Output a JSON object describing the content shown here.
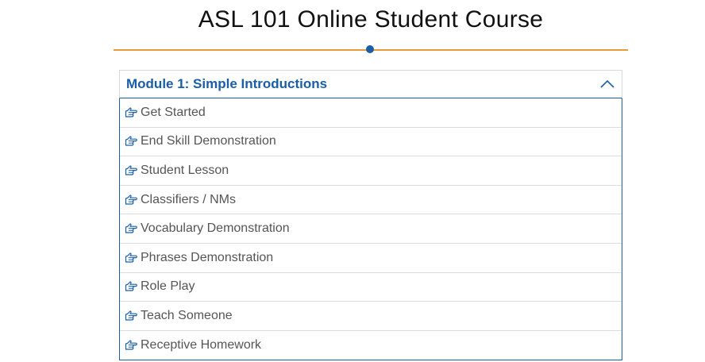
{
  "page": {
    "title": "ASL 101 Online Student Course"
  },
  "colors": {
    "accent_orange": "#e89a3c",
    "accent_blue": "#1a5ea8",
    "item_text": "#555555"
  },
  "module": {
    "header_label": "Module 1: Simple Introductions",
    "expanded": true,
    "items": [
      {
        "label": "Get Started",
        "icon": "pointing-hand-icon"
      },
      {
        "label": "End Skill Demonstration",
        "icon": "pointing-hand-icon"
      },
      {
        "label": "Student Lesson",
        "icon": "pointing-hand-icon"
      },
      {
        "label": "Classifiers / NMs",
        "icon": "pointing-hand-icon"
      },
      {
        "label": "Vocabulary Demonstration",
        "icon": "pointing-hand-icon"
      },
      {
        "label": "Phrases Demonstration",
        "icon": "pointing-hand-icon"
      },
      {
        "label": "Role Play",
        "icon": "pointing-hand-icon"
      },
      {
        "label": "Teach Someone",
        "icon": "pointing-hand-icon"
      },
      {
        "label": "Receptive Homework",
        "icon": "pointing-hand-icon"
      }
    ]
  }
}
